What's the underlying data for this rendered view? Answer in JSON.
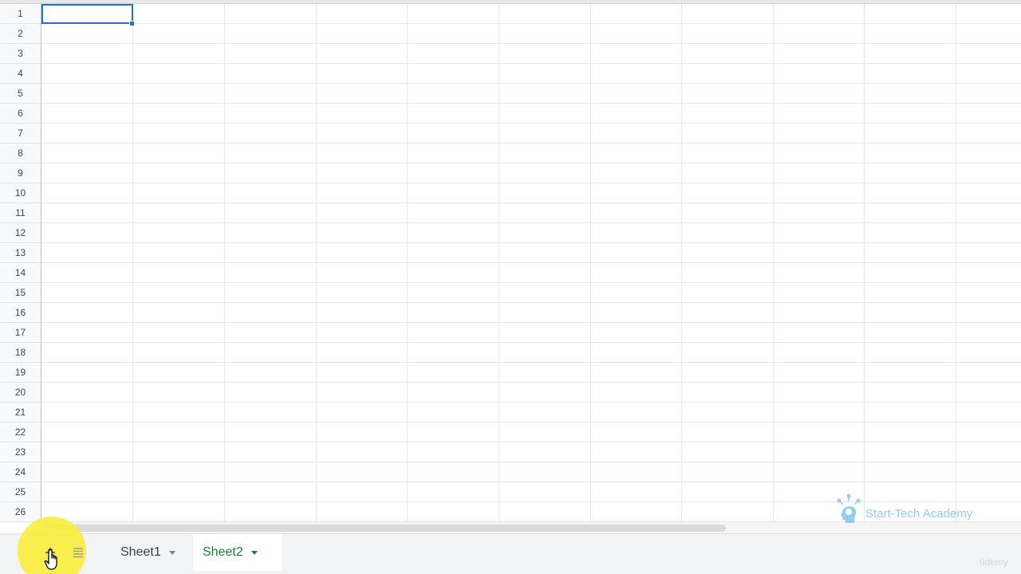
{
  "rows": [
    "1",
    "2",
    "3",
    "4",
    "5",
    "6",
    "7",
    "8",
    "9",
    "10",
    "11",
    "12",
    "13",
    "14",
    "15",
    "16",
    "17",
    "18",
    "19",
    "20",
    "21",
    "22",
    "23",
    "24",
    "25",
    "26"
  ],
  "sheet_tabs": [
    {
      "label": "Sheet1",
      "active": false
    },
    {
      "label": "Sheet2",
      "active": true
    }
  ],
  "active_tab_color": "#188038",
  "selection_color": "#1a73e8",
  "icons": {
    "add_sheet": "plus-icon",
    "all_sheets": "list-icon",
    "cursor": "hand-pointer-icon"
  },
  "watermark": {
    "text": "Start-Tech Academy"
  },
  "udemy": {
    "text": "ûdemy"
  }
}
